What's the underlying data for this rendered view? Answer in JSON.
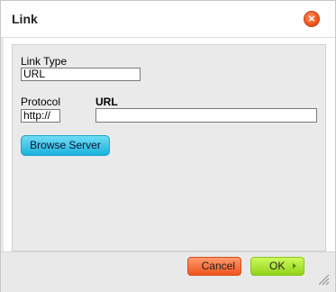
{
  "dialog": {
    "title": "Link",
    "close_icon": "close-icon",
    "close_symbol": "×"
  },
  "form": {
    "link_type_label": "Link Type",
    "link_type_value": "URL",
    "protocol_label": "Protocol",
    "protocol_value": "http://",
    "url_label": "URL",
    "url_value": "",
    "browse_label": "Browse Server"
  },
  "footer": {
    "cancel_label": "Cancel",
    "ok_label": "OK",
    "ok_icon": "chevron-right-icon",
    "resize_icon": "resize-grip-icon"
  },
  "colors": {
    "close": "#f15a24",
    "browse": "#19b2dc",
    "cancel": "#f0541f",
    "ok": "#8fd21a"
  }
}
